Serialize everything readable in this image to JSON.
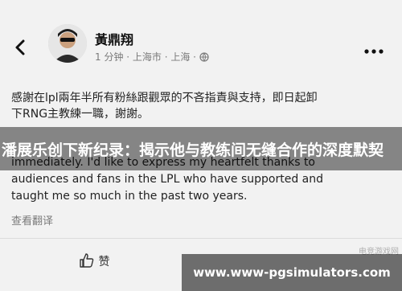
{
  "post": {
    "author": "黃鼎翔",
    "meta": "1 分钟 · 上海市 · 上海 ·",
    "original_text_line1": "感謝在lpl兩年半所有粉絲跟觀眾的不吝指責與支持，即日起卸",
    "original_text_line2": "下RNG主教練一職，謝謝。",
    "translated_line1": "immediately. I'd like to express my heartfelt thanks to",
    "translated_line2": "audiences and fans in the LPL who have supported and",
    "translated_line3": "taught me so much in the past two years.",
    "translate_link": "查看翻译",
    "like_label": "赞"
  },
  "overlay": {
    "headline": "潘展乐创下新纪录：揭示他与教练间无缝合作的深度默契"
  },
  "watermark": {
    "text": "www.www-pgsimulators.com",
    "faint_text": "电竞游戏网"
  },
  "icons": {
    "back": "chevron-left-icon",
    "globe": "globe-icon",
    "more": "more-horizontal-icon",
    "like": "thumbs-up-icon"
  }
}
